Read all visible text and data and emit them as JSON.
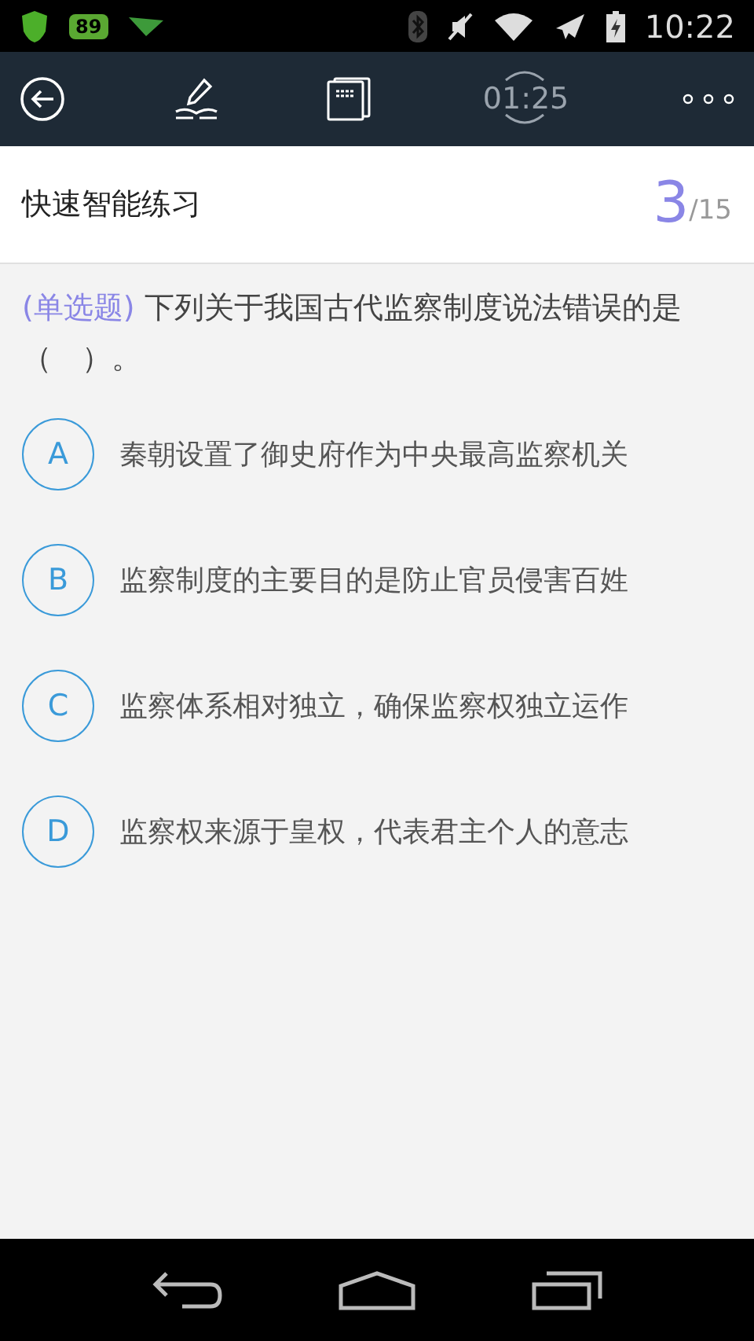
{
  "status_bar": {
    "battery_badge": "89",
    "time": "10:22"
  },
  "toolbar": {
    "timer": "01:25"
  },
  "header": {
    "title": "快速智能练习",
    "current": "3",
    "total": "/15"
  },
  "question": {
    "type": "(单选题)",
    "text": "下列关于我国古代监察制度说法错误的是（　）。"
  },
  "options": [
    {
      "letter": "A",
      "text": "秦朝设置了御史府作为中央最高监察机关"
    },
    {
      "letter": "B",
      "text": "监察制度的主要目的是防止官员侵害百姓"
    },
    {
      "letter": "C",
      "text": "监察体系相对独立，确保监察权独立运作"
    },
    {
      "letter": "D",
      "text": "监察权来源于皇权，代表君主个人的意志"
    }
  ]
}
